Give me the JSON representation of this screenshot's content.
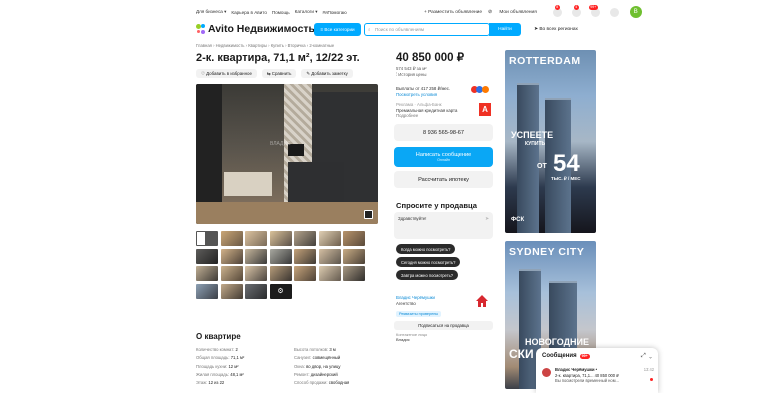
{
  "header": {
    "top_links": [
      "Для бизнеса ▾",
      "Карьера в Авито",
      "Помощь",
      "Каталоги ▾",
      "#яПомогаю"
    ],
    "post_ad": "+ Разместить объявление",
    "my_ads": "Мои объявления",
    "badges": [
      "8",
      "4",
      "99+"
    ],
    "avatar_letter": "B",
    "logo": "Avito Недвижимость",
    "all_categories": "Все категории",
    "search_placeholder": "Поиск по объявлениям",
    "search_button": "Найти",
    "region": "Во всех регионах"
  },
  "listing": {
    "breadcrumb": "Главная › Недвижимость › Квартиры › Купить › Вторичка › 2-комнатные",
    "title": "2-к. квартира, 71,1 м², 12/22 эт.",
    "actions": [
      "Добавить в избранное",
      "Сравнить",
      "Добавить заметку"
    ],
    "watermark": "ВЛАДИС",
    "price": "40 850 000 ₽",
    "price_per_m": "574 543 ₽ за м²",
    "price_history": "История цены",
    "installment": "Выплаты от 417 258 ₽/мес.",
    "installment_link": "Посмотреть условия",
    "bank_label": "Реклама · Альфа-Банк",
    "bank_line": "Премиальная кредитная карта",
    "bank_more": "Подробнее",
    "bank_logo": "А",
    "phone": "8 936 565-98-67",
    "message_btn": "Написать сообщение",
    "online": "Онлайн",
    "mortgage_btn": "Рассчитать ипотеку",
    "ask_title": "Спросите у продавца",
    "ask_text": "Здравствуйте!",
    "questions": [
      "Когда можно посмотреть?",
      "Сегодня можно посмотреть?",
      "Завтра можно посмотреть?"
    ],
    "seller_name": "Владис Черёмушки",
    "seller_type": "Агентство",
    "checked": "Реквизиты проверены",
    "subscribe": "Подписаться на продавца",
    "contact_label": "Контактное лицо",
    "contact_name": "Владис",
    "about_title": "О квартире",
    "specs": [
      {
        "k": "Количество комнат:",
        "v": "2"
      },
      {
        "k": "Высота потолков:",
        "v": "3 м"
      },
      {
        "k": "Общая площадь:",
        "v": "71,1 м²"
      },
      {
        "k": "Санузел:",
        "v": "совмещённый"
      },
      {
        "k": "Площадь кухни:",
        "v": "12 м²"
      },
      {
        "k": "Окна:",
        "v": "во двор, на улицу"
      },
      {
        "k": "Жилая площадь:",
        "v": "48,1 м²"
      },
      {
        "k": "Ремонт:",
        "v": "дизайнерский"
      },
      {
        "k": "Этаж:",
        "v": "12 из 22"
      },
      {
        "k": "Способ продажи:",
        "v": "свободная"
      }
    ]
  },
  "ads": {
    "ad1_title": "ROTTERDAM",
    "ad1_l1": "УСПЕЕТЕ",
    "ad1_l2": "КУПИТЬ",
    "ad1_from": "ОТ",
    "ad1_big": "54",
    "ad1_unit": "ТЫС. ₽ / МЕС",
    "ad1_brand": "ФСК",
    "ad2_title": "SYDNEY CITY",
    "ad2_l1": "НОВОГОДНИЕ",
    "ad2_l2": "СКИ"
  },
  "messages": {
    "title": "Сообщения",
    "count": "99+",
    "from": "Владис Черёмушки •",
    "preview": "2-к. квартира, 71,1...  40 850 000 ₽",
    "preview2": "Вы посмотрели временный ном...",
    "time": "13:42"
  },
  "colors": {
    "accent": "#00aaff",
    "message": "#0aa7f5",
    "alfa": "#ef3124"
  }
}
